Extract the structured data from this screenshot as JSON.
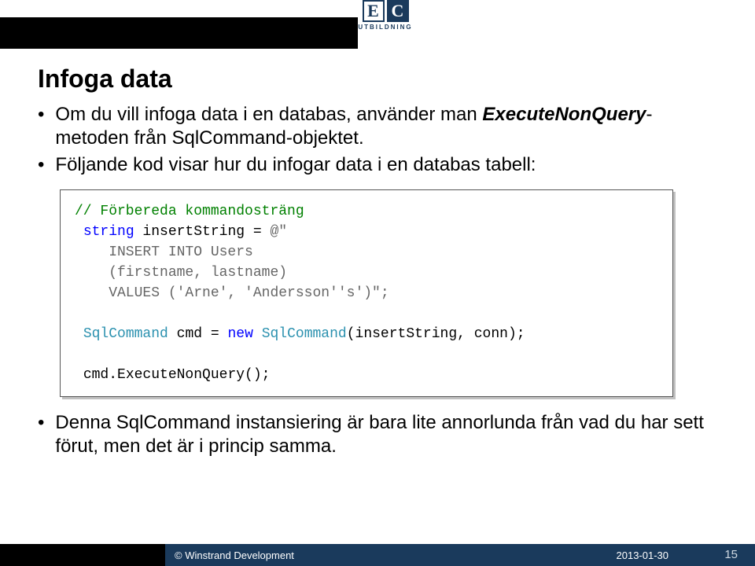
{
  "logo": {
    "e": "E",
    "c": "C",
    "sub": "UTBILDNING"
  },
  "title": "Infoga data",
  "bullets": {
    "b1a": "Om du vill infoga data i en databas, använder man ",
    "b1b": "ExecuteNonQuery",
    "b1c": "-metoden från SqlCommand-objektet.",
    "b2": "Följande kod visar hur du infogar data i en databas tabell:",
    "b3": "Denna SqlCommand instansiering är bara lite annorlunda från vad du har sett förut, men det är i princip samma."
  },
  "code": {
    "comment": "// Förbereda kommandosträng",
    "kw_string": "string",
    "var_insert": " insertString = ",
    "str_at": "@\"",
    "str_l1": "    INSERT INTO Users",
    "str_l2": "    (firstname, lastname)",
    "str_l3": "    VALUES ('Arne', 'Andersson''s')\";",
    "type_sqlcmd1": "SqlCommand",
    "mid1": " cmd = ",
    "kw_new": "new",
    "sp": " ",
    "type_sqlcmd2": "SqlCommand",
    "paren": "(insertString, conn);",
    "exec": "cmd.ExecuteNonQuery();"
  },
  "footer": {
    "copyright": "© Winstrand Development",
    "date": "2013-01-30",
    "page": "15"
  }
}
